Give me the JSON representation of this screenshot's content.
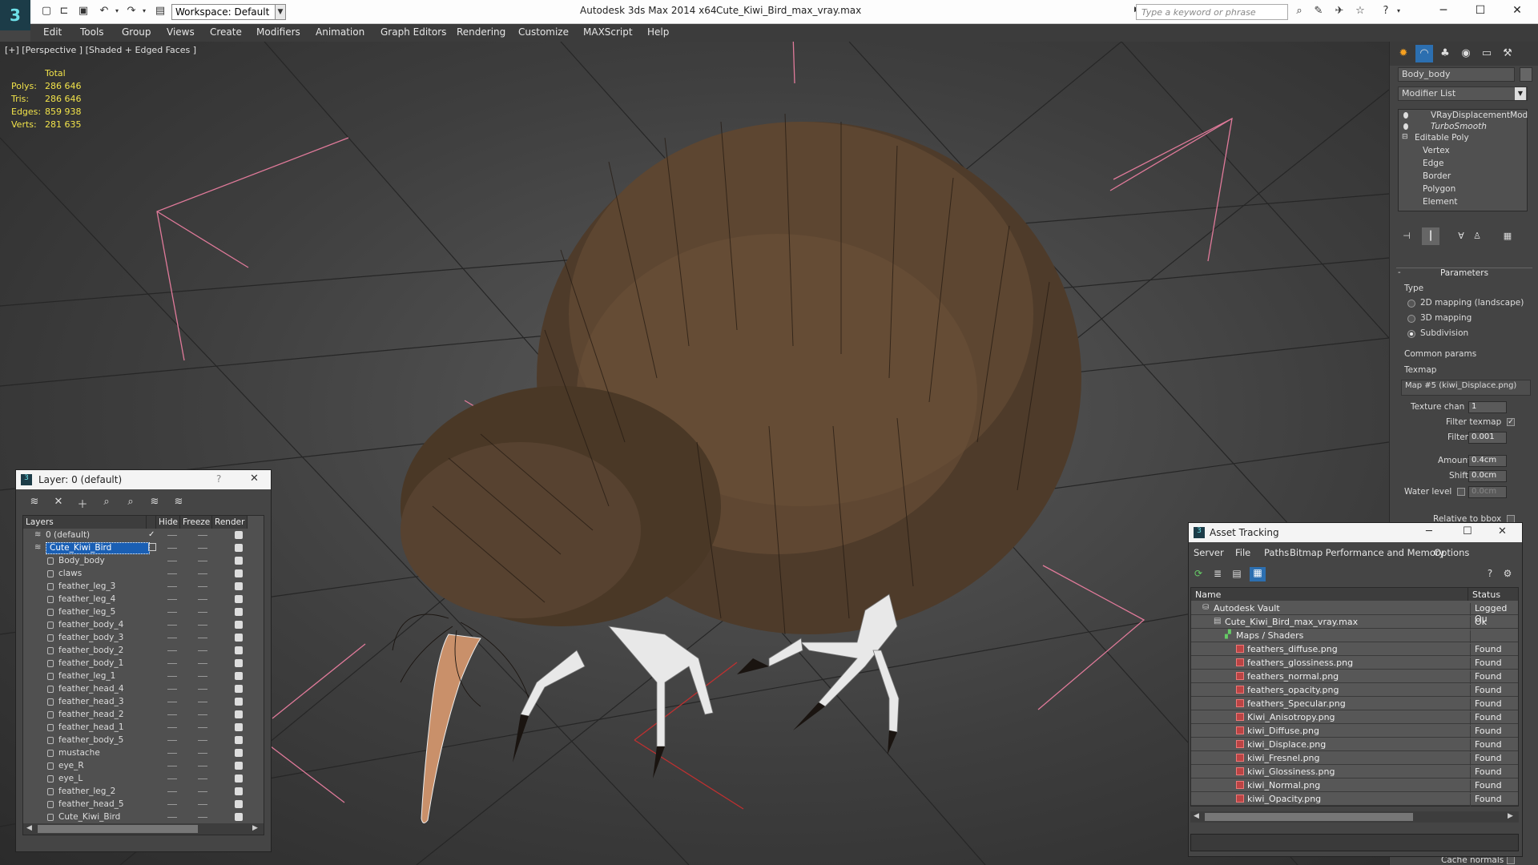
{
  "titlebar": {
    "app_title": "Autodesk 3ds Max  2014 x64",
    "file_title": "Cute_Kiwi_Bird_max_vray.max",
    "workspace": "Workspace: Default",
    "search_placeholder": "Type a keyword or phrase"
  },
  "menu": [
    "Edit",
    "Tools",
    "Group",
    "Views",
    "Create",
    "Modifiers",
    "Animation",
    "Graph Editors",
    "Rendering",
    "Customize",
    "MAXScript",
    "Help"
  ],
  "viewport": {
    "label": "[+] [Perspective ] [Shaded + Edged Faces ]",
    "stats_header": "Total",
    "stats": [
      {
        "label": "Polys:",
        "value": "286 646"
      },
      {
        "label": "Tris:",
        "value": "286 646"
      },
      {
        "label": "Edges:",
        "value": "859 938"
      },
      {
        "label": "Verts:",
        "value": "281 635"
      }
    ]
  },
  "command_panel": {
    "object_name": "Body_body",
    "modifier_list": "Modifier List",
    "stack": [
      "VRayDisplacementMod",
      "TurboSmooth",
      "Editable Poly",
      "Vertex",
      "Edge",
      "Border",
      "Polygon",
      "Element"
    ],
    "parameters_title": "Parameters",
    "type_label": "Type",
    "type_options": [
      "2D mapping (landscape)",
      "3D mapping",
      "Subdivision"
    ],
    "type_selected": 2,
    "common_params": "Common params",
    "texmap_label": "Texmap",
    "texmap_value": "Map #5 (kiwi_Displace.png)",
    "texture_chan_label": "Texture chan",
    "texture_chan_value": "1",
    "filter_texmap": "Filter texmap",
    "filter_blur_label": "Filter blur",
    "filter_blur_value": "0.001",
    "amount_label": "Amount",
    "amount_value": "0.4cm",
    "shift_label": "Shift",
    "shift_value": "0.0cm",
    "water_level_label": "Water level",
    "water_level_value": "0.0cm",
    "relative_bbox": "Relative to bbox",
    "cache_normals": "Cache normals"
  },
  "layer_dialog": {
    "title": "Layer: 0 (default)",
    "columns": [
      "Layers",
      "Hide",
      "Freeze",
      "Render"
    ],
    "rows": [
      {
        "name": "0 (default)",
        "level": 0,
        "kind": "layer"
      },
      {
        "name": "Cute_Kiwi_Bird",
        "level": 0,
        "kind": "layer",
        "selected": true
      },
      {
        "name": "Body_body",
        "level": 1,
        "kind": "obj"
      },
      {
        "name": "claws",
        "level": 1,
        "kind": "obj"
      },
      {
        "name": "feather_leg_3",
        "level": 1,
        "kind": "obj"
      },
      {
        "name": "feather_leg_4",
        "level": 1,
        "kind": "obj"
      },
      {
        "name": "feather_leg_5",
        "level": 1,
        "kind": "obj"
      },
      {
        "name": "feather_body_4",
        "level": 1,
        "kind": "obj"
      },
      {
        "name": "feather_body_3",
        "level": 1,
        "kind": "obj"
      },
      {
        "name": "feather_body_2",
        "level": 1,
        "kind": "obj"
      },
      {
        "name": "feather_body_1",
        "level": 1,
        "kind": "obj"
      },
      {
        "name": "feather_leg_1",
        "level": 1,
        "kind": "obj"
      },
      {
        "name": "feather_head_4",
        "level": 1,
        "kind": "obj"
      },
      {
        "name": "feather_head_3",
        "level": 1,
        "kind": "obj"
      },
      {
        "name": "feather_head_2",
        "level": 1,
        "kind": "obj"
      },
      {
        "name": "feather_head_1",
        "level": 1,
        "kind": "obj"
      },
      {
        "name": "feather_body_5",
        "level": 1,
        "kind": "obj"
      },
      {
        "name": "mustache",
        "level": 1,
        "kind": "obj"
      },
      {
        "name": "eye_R",
        "level": 1,
        "kind": "obj"
      },
      {
        "name": "eye_L",
        "level": 1,
        "kind": "obj"
      },
      {
        "name": "feather_leg_2",
        "level": 1,
        "kind": "obj"
      },
      {
        "name": "feather_head_5",
        "level": 1,
        "kind": "obj"
      },
      {
        "name": "Cute_Kiwi_Bird",
        "level": 1,
        "kind": "obj"
      }
    ]
  },
  "asset_tracking": {
    "title": "Asset Tracking",
    "menu": [
      "Server",
      "File",
      "Paths",
      "Bitmap Performance and Memory",
      "Options"
    ],
    "columns": [
      "Name",
      "Status"
    ],
    "rows": [
      {
        "name": "Autodesk Vault",
        "status": "Logged Ou",
        "level": 0
      },
      {
        "name": "Cute_Kiwi_Bird_max_vray.max",
        "status": "Ok",
        "level": 1
      },
      {
        "name": "Maps / Shaders",
        "status": "",
        "level": 2
      },
      {
        "name": "feathers_diffuse.png",
        "status": "Found",
        "level": 3
      },
      {
        "name": "feathers_glossiness.png",
        "status": "Found",
        "level": 3
      },
      {
        "name": "feathers_normal.png",
        "status": "Found",
        "level": 3
      },
      {
        "name": "feathers_opacity.png",
        "status": "Found",
        "level": 3
      },
      {
        "name": "feathers_Specular.png",
        "status": "Found",
        "level": 3
      },
      {
        "name": "Kiwi_Anisotropy.png",
        "status": "Found",
        "level": 3
      },
      {
        "name": "kiwi_Diffuse.png",
        "status": "Found",
        "level": 3
      },
      {
        "name": "kiwi_Displace.png",
        "status": "Found",
        "level": 3
      },
      {
        "name": "kiwi_Fresnel.png",
        "status": "Found",
        "level": 3
      },
      {
        "name": "kiwi_Glossiness.png",
        "status": "Found",
        "level": 3
      },
      {
        "name": "kiwi_Normal.png",
        "status": "Found",
        "level": 3
      },
      {
        "name": "kiwi_Opacity.png",
        "status": "Found",
        "level": 3
      }
    ]
  },
  "colors": {
    "stats_yellow": "#f2e34a",
    "selection_blue": "#1a5fb4",
    "bbox_pink": "#e07a9a",
    "feather_brown": "#5a4330"
  }
}
